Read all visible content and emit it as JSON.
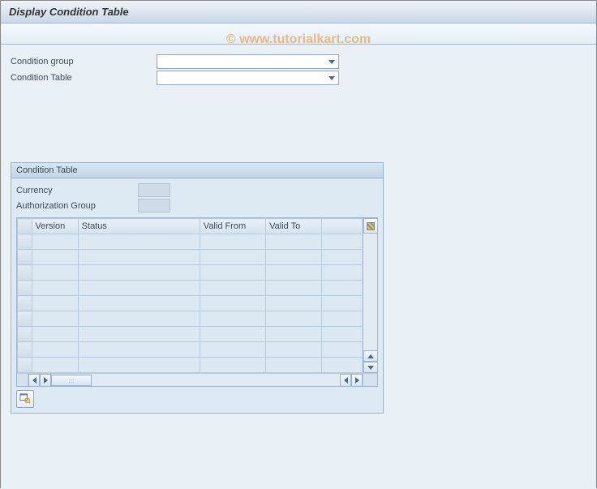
{
  "header": {
    "title": "Display Condition Table"
  },
  "watermark": "© www.tutorialkart.com",
  "fields": {
    "condition_group_label": "Condition group",
    "condition_group_value": "",
    "condition_table_label": "Condition Table",
    "condition_table_value": ""
  },
  "group": {
    "title": "Condition Table",
    "currency_label": "Currency",
    "currency_value": "",
    "auth_group_label": "Authorization Group",
    "auth_group_value": ""
  },
  "table": {
    "columns": {
      "version": "Version",
      "status": "Status",
      "valid_from": "Valid From",
      "valid_to": "Valid To"
    },
    "rows": [
      {
        "version": "",
        "status": "",
        "valid_from": "",
        "valid_to": ""
      },
      {
        "version": "",
        "status": "",
        "valid_from": "",
        "valid_to": ""
      },
      {
        "version": "",
        "status": "",
        "valid_from": "",
        "valid_to": ""
      },
      {
        "version": "",
        "status": "",
        "valid_from": "",
        "valid_to": ""
      },
      {
        "version": "",
        "status": "",
        "valid_from": "",
        "valid_to": ""
      },
      {
        "version": "",
        "status": "",
        "valid_from": "",
        "valid_to": ""
      },
      {
        "version": "",
        "status": "",
        "valid_from": "",
        "valid_to": ""
      },
      {
        "version": "",
        "status": "",
        "valid_from": "",
        "valid_to": ""
      },
      {
        "version": "",
        "status": "",
        "valid_from": "",
        "valid_to": ""
      }
    ]
  },
  "hscroll_thumb": ":::"
}
